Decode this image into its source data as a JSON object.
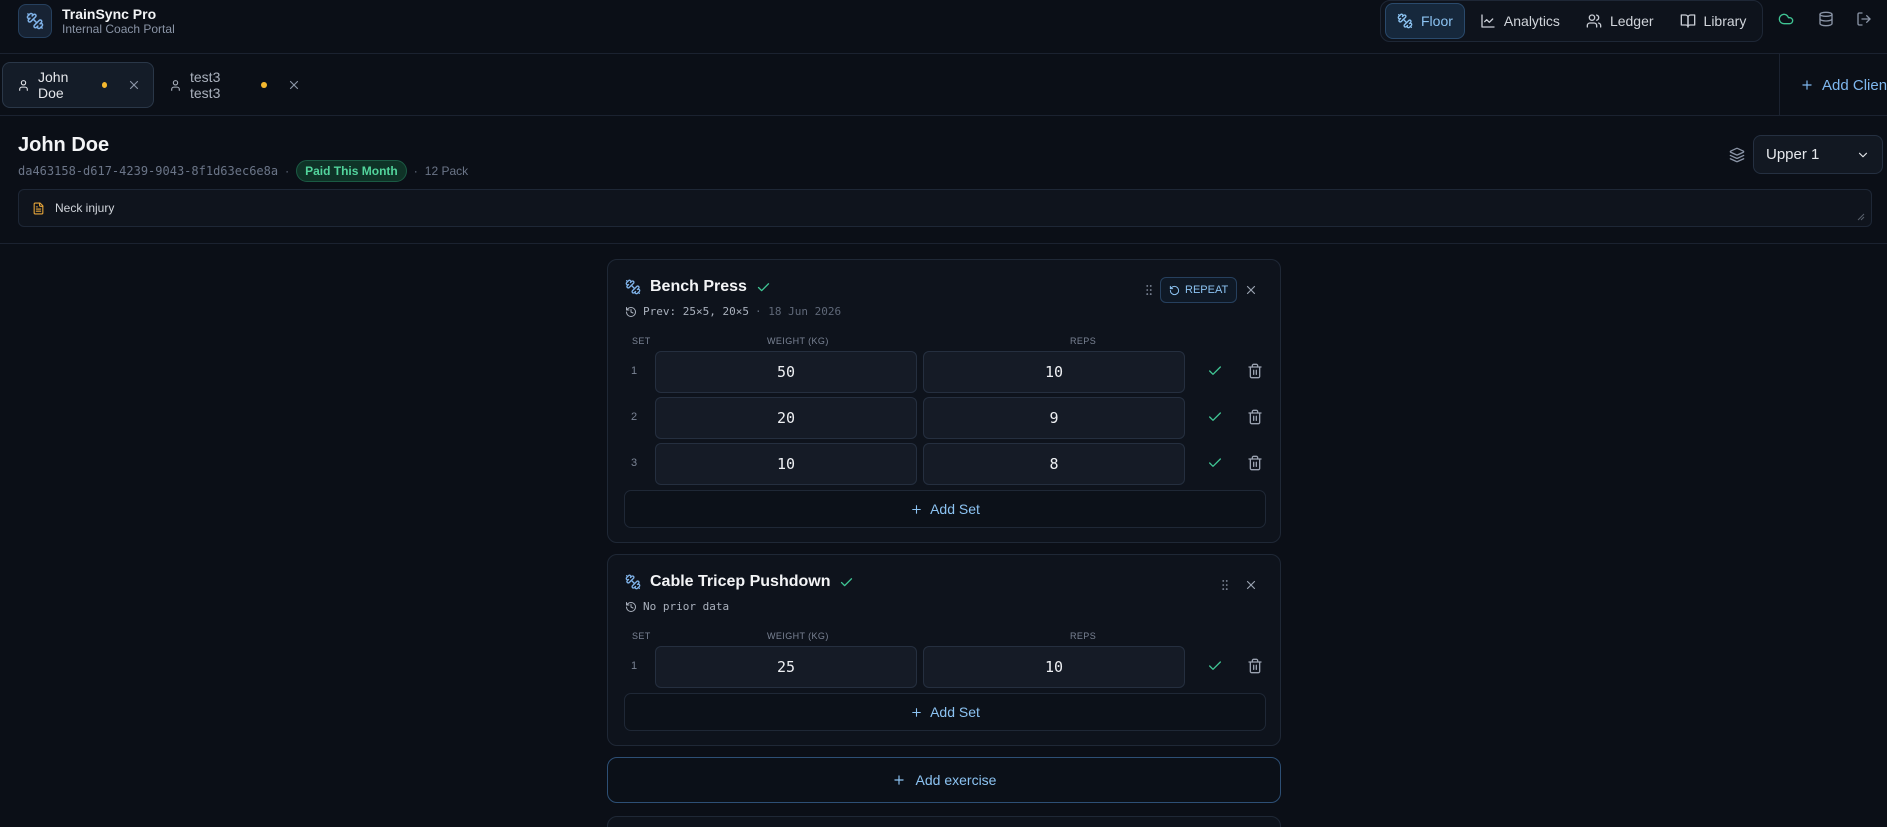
{
  "app": {
    "title": "TrainSync Pro",
    "subtitle": "Internal Coach Portal"
  },
  "nav": {
    "items": [
      {
        "label": "Floor",
        "icon": "dumbbell-icon",
        "active": true
      },
      {
        "label": "Analytics",
        "icon": "chart-line-icon",
        "active": false
      },
      {
        "label": "Ledger",
        "icon": "users-icon",
        "active": false
      },
      {
        "label": "Library",
        "icon": "book-open-icon",
        "active": false
      }
    ],
    "utility_icons": [
      "cloud-icon",
      "database-icon",
      "logout-icon"
    ]
  },
  "tabs": [
    {
      "label": "John Doe",
      "active": true,
      "unsaved": true
    },
    {
      "label": "test3 test3",
      "active": false,
      "unsaved": true
    }
  ],
  "add_client_label": "Add Client",
  "client": {
    "name": "John Doe",
    "id": "da463158-d617-4239-9043-8f1d63ec6e8a",
    "sep": "·",
    "payment_status": "Paid This Month",
    "package": "12 Pack",
    "routine": "Upper 1",
    "notes": "Neck injury"
  },
  "set_table_headers": {
    "set": "SET",
    "weight": "WEIGHT (KG)",
    "reps": "REPS"
  },
  "exercises": [
    {
      "name": "Bench Press",
      "completed": true,
      "prev": "Prev: 25×5, 20×5",
      "prev_date": "· 18 Jun 2026",
      "repeat_label": "REPEAT",
      "sets": [
        {
          "num": "1",
          "weight": "50",
          "reps": "10"
        },
        {
          "num": "2",
          "weight": "20",
          "reps": "9"
        },
        {
          "num": "3",
          "weight": "10",
          "reps": "8"
        }
      ],
      "add_set_label": "Add Set"
    },
    {
      "name": "Cable Tricep Pushdown",
      "completed": true,
      "prev": "No prior data",
      "sets": [
        {
          "num": "1",
          "weight": "25",
          "reps": "10"
        }
      ],
      "add_set_label": "Add Set"
    }
  ],
  "add_exercise_label": "Add exercise",
  "colors": {
    "accent": "#8cc3f2",
    "success": "#3fc493",
    "warning": "#f5b82e",
    "background": "#0b0f17"
  }
}
